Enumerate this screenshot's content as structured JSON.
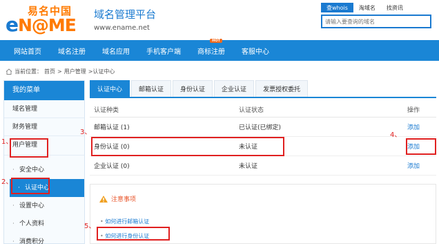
{
  "logo": {
    "cn": "易名中国",
    "en_prefix": "e",
    "en_rest": "N@ME"
  },
  "site": {
    "title": "域名管理平台",
    "url": "www.ename.net"
  },
  "search": {
    "tabs": [
      "查whois",
      "淘域名",
      "找资讯"
    ],
    "placeholder": "请输入要查询的域名"
  },
  "nav": {
    "items": [
      "网站首页",
      "域名注册",
      "域名应用",
      "手机客户端",
      "商标注册",
      "客服中心"
    ],
    "hot_badge": "HOT"
  },
  "breadcrumb": {
    "prefix": "当前位置：",
    "home": "首页",
    "sep1": ">",
    "user": "用户管理",
    "current": ">认证中心"
  },
  "sidebar": {
    "title": "我的菜单",
    "items": [
      "域名管理",
      "财务管理",
      "用户管理"
    ],
    "sub_items": [
      "安全中心",
      "认证中心",
      "设置中心",
      "个人资料",
      "消费积分"
    ]
  },
  "tabs": [
    "认证中心",
    "邮箱认证",
    "身份认证",
    "企业认证",
    "发票授权委托"
  ],
  "table": {
    "headers": [
      "认证种类",
      "认证状态",
      "操作"
    ],
    "rows": [
      {
        "type": "邮箱认证 (1)",
        "status": "已认证(已绑定)",
        "action": "添加"
      },
      {
        "type": "身份认证 (0)",
        "status": "未认证",
        "action": "添加"
      },
      {
        "type": "企业认证 (0)",
        "status": "未认证",
        "action": "添加"
      }
    ]
  },
  "notice": {
    "title": "注意事项",
    "links": [
      "如何进行邮箱认证",
      "如何进行身份认证"
    ]
  },
  "annotations": [
    "1、",
    "2、",
    "3、",
    "4、",
    "5、"
  ],
  "colors": {
    "brand_blue": "#1a86d6",
    "brand_orange": "#ff7a00",
    "annotation_red": "#e02020"
  }
}
